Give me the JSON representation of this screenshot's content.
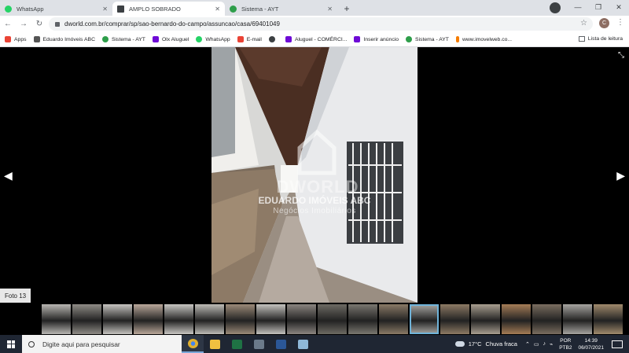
{
  "browser": {
    "tabs": [
      {
        "label": "WhatsApp",
        "icon": "whatsapp-icon",
        "color": "#25d366",
        "active": false
      },
      {
        "label": "AMPLO SOBRADO",
        "icon": "house-icon",
        "color": "#3c4043",
        "active": true
      },
      {
        "label": "Sistema - AYT",
        "icon": "ayt-icon",
        "color": "#2e9e4a",
        "active": false
      }
    ],
    "newtab": "+",
    "url": "dworld.com.br/comprar/sp/sao-bernardo-do-campo/assuncao/casa/69401049",
    "profile_initial": "C",
    "nav": {
      "back": "←",
      "forward": "→",
      "reload": "↻"
    },
    "window_controls": {
      "minimize": "—",
      "maximize": "❐",
      "close": "✕"
    },
    "star": "☆",
    "menu": "⋮"
  },
  "bookmarks": {
    "items": [
      {
        "label": "Apps",
        "icon": "apps-grid-icon",
        "color": "#ea4335"
      },
      {
        "label": "Eduardo Imóveis ABC",
        "icon": "eduardo-icon",
        "color": "#555555"
      },
      {
        "label": "Sistema - AYT",
        "icon": "ayt-icon",
        "color": "#2e9e4a"
      },
      {
        "label": "Olx Aluguel",
        "icon": "olx-icon",
        "color": "#6e0ad6"
      },
      {
        "label": "WhatsApp",
        "icon": "whatsapp-icon",
        "color": "#25d366"
      },
      {
        "label": "E-mail",
        "icon": "mail-icon",
        "color": "#ea4335"
      },
      {
        "label": "",
        "icon": "globe-icon",
        "color": "#3c4043"
      },
      {
        "label": "Aluguel - COMÉRCI...",
        "icon": "olx-icon",
        "color": "#6e0ad6"
      },
      {
        "label": "Inserir anúncio",
        "icon": "olx-icon",
        "color": "#6e0ad6"
      },
      {
        "label": "Sistema - AYT",
        "icon": "ayt-icon",
        "color": "#2e9e4a"
      },
      {
        "label": "www.imovelweb.co...",
        "icon": "imovelweb-icon",
        "color": "#f57c00"
      }
    ],
    "reading_list": "Lista de leitura"
  },
  "viewer": {
    "photo_label": "Foto 13",
    "watermark_brand": "DWORLD",
    "watermark_title": "EDUARDO IMÓVEIS ABC",
    "watermark_subtitle": "Negócios Imobiliários",
    "prev_arrow": "◀",
    "next_arrow": "▶",
    "expand": "⤡",
    "thumbnails": [
      {
        "color": "#b8b6b2",
        "selected": false
      },
      {
        "color": "#8f8c86",
        "selected": false
      },
      {
        "color": "#c6c4c0",
        "selected": false
      },
      {
        "color": "#b9a79a",
        "selected": false
      },
      {
        "color": "#c8c6c2",
        "selected": false
      },
      {
        "color": "#bdbbb6",
        "selected": false
      },
      {
        "color": "#9b8a78",
        "selected": false
      },
      {
        "color": "#c4c2be",
        "selected": false
      },
      {
        "color": "#8b8580",
        "selected": false
      },
      {
        "color": "#6d6a63",
        "selected": false
      },
      {
        "color": "#7a7770",
        "selected": false
      },
      {
        "color": "#8a7a66",
        "selected": false
      },
      {
        "color": "#a9a8a4",
        "selected": true
      },
      {
        "color": "#8d7a64",
        "selected": false
      },
      {
        "color": "#a89e90",
        "selected": false
      },
      {
        "color": "#a57c56",
        "selected": false
      },
      {
        "color": "#7a6d5f",
        "selected": false
      },
      {
        "color": "#a6a4a0",
        "selected": false
      },
      {
        "color": "#a08a6c",
        "selected": false
      }
    ]
  },
  "taskbar": {
    "search_placeholder": "Digite aqui para pesquisar",
    "apps": [
      {
        "name": "chrome-app",
        "color": "#e0b030",
        "active": true
      },
      {
        "name": "file-explorer-app",
        "color": "#f0c040",
        "active": false
      },
      {
        "name": "excel-app",
        "color": "#1f7244",
        "active": false
      },
      {
        "name": "calculator-app",
        "color": "#6b7a8a",
        "active": false
      },
      {
        "name": "word-app",
        "color": "#2b5797",
        "active": false
      },
      {
        "name": "generic-app",
        "color": "#8fb8d8",
        "active": false
      }
    ],
    "temperature": "17°C",
    "weather": "Chuva fraca",
    "lang_line1": "POR",
    "lang_line2": "PTB2",
    "time": "14:39",
    "date": "06/07/2021",
    "tray_icons": [
      "⌃",
      "▭",
      "♪",
      "⌁"
    ]
  }
}
